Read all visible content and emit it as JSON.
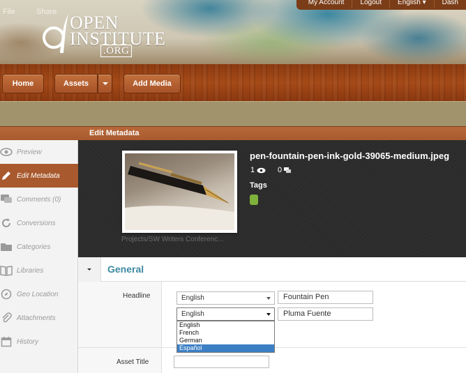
{
  "topnav": {
    "items": [
      "My Account",
      "Logout",
      "English ▾",
      "Dash"
    ]
  },
  "logo": {
    "line1": "OPEN",
    "line2": "INSTITUTE",
    "line3": ".ORG"
  },
  "mainnav": {
    "home": "Home",
    "assets": "Assets",
    "add_media": "Add Media"
  },
  "actionbar": {
    "file": "File",
    "share": "Share"
  },
  "section": {
    "title": "Edit Metadata"
  },
  "sidebar": {
    "items": [
      {
        "label": "Preview",
        "icon": "eye-icon"
      },
      {
        "label": "Edit Metadata",
        "icon": "pencil-icon"
      },
      {
        "label": "Comments (0)",
        "icon": "comment-icon"
      },
      {
        "label": "Conversions",
        "icon": "refresh-icon"
      },
      {
        "label": "Categories",
        "icon": "folder-icon"
      },
      {
        "label": "Libraries",
        "icon": "book-icon"
      },
      {
        "label": "Geo Location",
        "icon": "compass-icon"
      },
      {
        "label": "Attachments",
        "icon": "paperclip-icon"
      },
      {
        "label": "History",
        "icon": "calendar-icon"
      }
    ]
  },
  "asset": {
    "filename": "pen-fountain-pen-ink-gold-39065-medium.jpeg",
    "views": "1",
    "comments": "0",
    "tags_label": "Tags",
    "path": "Projects/SW Writers Conferenc..."
  },
  "accordion": {
    "title": "General"
  },
  "form": {
    "headline_label": "Headline",
    "asset_title_label": "Asset Title",
    "headline_rows": [
      {
        "language": "English",
        "value": "Fountain Pen"
      },
      {
        "language": "English",
        "value": "Pluma Fuente"
      }
    ],
    "asset_title_value": "",
    "language_options": [
      "English",
      "French",
      "German",
      "Español"
    ],
    "highlighted_option": "Español"
  },
  "colors": {
    "accent": "#a85a2e",
    "title_blue": "#3d8aa0",
    "tag_green": "#7fb23a",
    "selection_blue": "#3c7fc4"
  }
}
